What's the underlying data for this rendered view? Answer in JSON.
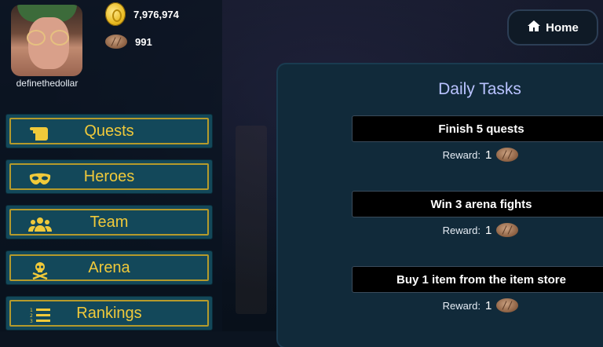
{
  "player": {
    "username": "definethedollar",
    "coins": "7,976,974",
    "bread": "991"
  },
  "home": {
    "label": "Home",
    "icon": "home-icon"
  },
  "menu": [
    {
      "label": "Quests",
      "icon": "scroll-icon"
    },
    {
      "label": "Heroes",
      "icon": "mask-icon"
    },
    {
      "label": "Team",
      "icon": "group-icon"
    },
    {
      "label": "Arena",
      "icon": "skull-crossbones-icon"
    },
    {
      "label": "Rankings",
      "icon": "ordered-list-icon"
    }
  ],
  "panel": {
    "title": "Daily Tasks",
    "reward_label": "Reward:",
    "tasks": [
      {
        "name": "Finish 5 quests",
        "reward": "1"
      },
      {
        "name": "Win 3 arena fights",
        "reward": "1"
      },
      {
        "name": "Buy 1 item from the item store",
        "reward": "1"
      }
    ]
  },
  "colors": {
    "menu_text": "#f0c93a",
    "menu_border": "#b59a2b",
    "menu_bg": "#13485a",
    "title": "#b9c3ff"
  }
}
